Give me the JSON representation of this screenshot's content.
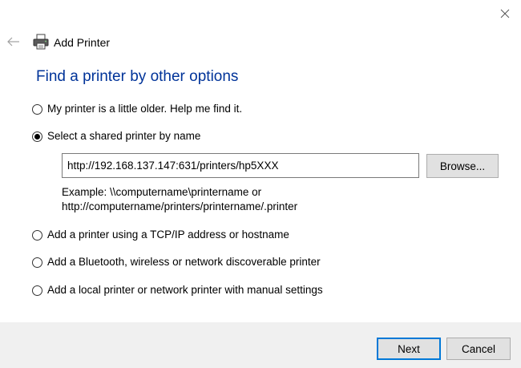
{
  "window": {
    "title": "Add Printer"
  },
  "header": {
    "back_icon": "back-arrow-icon",
    "printer_icon": "printer-icon",
    "title": "Add Printer"
  },
  "page": {
    "heading": "Find a printer by other options"
  },
  "options": [
    {
      "label": "My printer is a little older. Help me find it.",
      "selected": false
    },
    {
      "label": "Select a shared printer by name",
      "selected": true
    },
    {
      "label": "Add a printer using a TCP/IP address or hostname",
      "selected": false
    },
    {
      "label": "Add a Bluetooth, wireless or network discoverable printer",
      "selected": false
    },
    {
      "label": "Add a local printer or network printer with manual settings",
      "selected": false
    }
  ],
  "shared_printer": {
    "value": "http://192.168.137.147:631/printers/hp5XXX",
    "browse_label": "Browse...",
    "example_line1": "Example: \\\\computername\\printername or",
    "example_line2": "http://computername/printers/printername/.printer"
  },
  "footer": {
    "next_label": "Next",
    "cancel_label": "Cancel"
  },
  "colors": {
    "heading": "#003399",
    "accent": "#0078d7",
    "footer_bg": "#f0f0f0"
  }
}
